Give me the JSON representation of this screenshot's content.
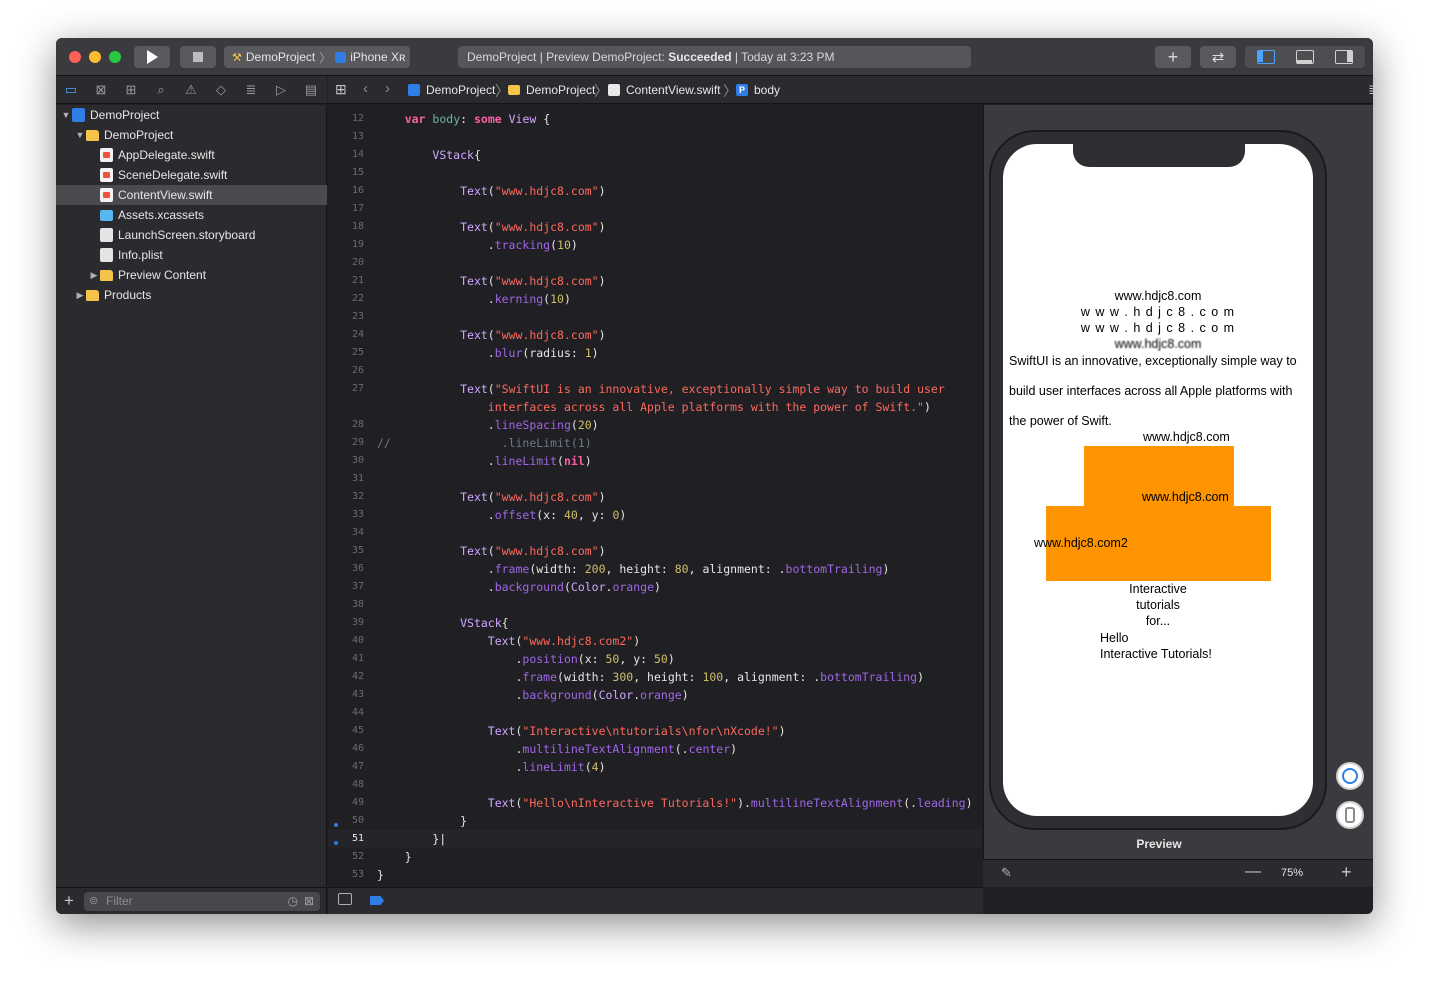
{
  "window": {
    "scheme": {
      "project": "DemoProject",
      "device": "iPhone Xʀ"
    },
    "status": {
      "prefix": "DemoProject | Preview DemoProject: ",
      "result": "Succeeded",
      "time": " | Today at 3:23 PM"
    }
  },
  "navigator": {
    "items": [
      {
        "label": "DemoProject",
        "indent": 0,
        "icon": "project-icon",
        "disclosure": "▼"
      },
      {
        "label": "DemoProject",
        "indent": 1,
        "icon": "folder-icon",
        "disclosure": "▼"
      },
      {
        "label": "AppDelegate.swift",
        "indent": 2,
        "icon": "swift-file-icon",
        "disclosure": ""
      },
      {
        "label": "SceneDelegate.swift",
        "indent": 2,
        "icon": "swift-file-icon",
        "disclosure": ""
      },
      {
        "label": "ContentView.swift",
        "indent": 2,
        "icon": "swift-file-icon",
        "disclosure": "",
        "selected": true
      },
      {
        "label": "Assets.xcassets",
        "indent": 2,
        "icon": "assets-icon",
        "disclosure": ""
      },
      {
        "label": "LaunchScreen.storyboard",
        "indent": 2,
        "icon": "storyboard-icon",
        "disclosure": ""
      },
      {
        "label": "Info.plist",
        "indent": 2,
        "icon": "plist-icon",
        "disclosure": ""
      },
      {
        "label": "Preview Content",
        "indent": 2,
        "icon": "folder-icon",
        "disclosure": "▶"
      },
      {
        "label": "Products",
        "indent": 1,
        "icon": "folder-icon",
        "disclosure": "▶"
      }
    ],
    "filter_placeholder": "Filter"
  },
  "jumpbar": {
    "crumbs": [
      "DemoProject",
      "DemoProject",
      "ContentView.swift",
      "body"
    ]
  },
  "editor": {
    "current_line": "51",
    "lines": [
      {
        "n": "12",
        "html": "    <span class='kw'>var</span> <span class='pr'>body</span>: <span class='kw'>some</span> <span class='ty'>View</span> {"
      },
      {
        "n": "13",
        "html": ""
      },
      {
        "n": "14",
        "html": "        <span class='ty'>VStack</span>{"
      },
      {
        "n": "15",
        "html": ""
      },
      {
        "n": "16",
        "html": "            <span class='ty'>Text</span>(<span class='str'>\"www.hdjc8.com\"</span>)"
      },
      {
        "n": "17",
        "html": ""
      },
      {
        "n": "18",
        "html": "            <span class='ty'>Text</span>(<span class='str'>\"www.hdjc8.com\"</span>)"
      },
      {
        "n": "19",
        "html": "                .<span class='fn'>tracking</span>(<span class='num'>10</span>)"
      },
      {
        "n": "20",
        "html": ""
      },
      {
        "n": "21",
        "html": "            <span class='ty'>Text</span>(<span class='str'>\"www.hdjc8.com\"</span>)"
      },
      {
        "n": "22",
        "html": "                .<span class='fn'>kerning</span>(<span class='num'>10</span>)"
      },
      {
        "n": "23",
        "html": ""
      },
      {
        "n": "24",
        "html": "            <span class='ty'>Text</span>(<span class='str'>\"www.hdjc8.com\"</span>)"
      },
      {
        "n": "25",
        "html": "                .<span class='fn'>blur</span>(radius: <span class='num'>1</span>)"
      },
      {
        "n": "26",
        "html": ""
      },
      {
        "n": "27",
        "html": "            <span class='ty'>Text</span>(<span class='str'>\"SwiftUI is an innovative, exceptionally simple way to build user</span>"
      },
      {
        "n": "",
        "html": "                <span class='str'>interfaces across all Apple platforms with the power of Swift.\"</span>)"
      },
      {
        "n": "28",
        "html": "                .<span class='fn'>lineSpacing</span>(<span class='num'>20</span>)"
      },
      {
        "n": "29",
        "html": "<span class='cm'>//                .lineLimit(1)</span>"
      },
      {
        "n": "30",
        "html": "                .<span class='fn'>lineLimit</span>(<span class='kw'>nil</span>)"
      },
      {
        "n": "31",
        "html": ""
      },
      {
        "n": "32",
        "html": "            <span class='ty'>Text</span>(<span class='str'>\"www.hdjc8.com\"</span>)"
      },
      {
        "n": "33",
        "html": "                .<span class='fn'>offset</span>(x: <span class='num'>40</span>, y: <span class='num'>0</span>)"
      },
      {
        "n": "34",
        "html": ""
      },
      {
        "n": "35",
        "html": "            <span class='ty'>Text</span>(<span class='str'>\"www.hdjc8.com\"</span>)"
      },
      {
        "n": "36",
        "html": "                .<span class='fn'>frame</span>(width: <span class='num'>200</span>, height: <span class='num'>80</span>, alignment: .<span class='fn'>bottomTrailing</span>)"
      },
      {
        "n": "37",
        "html": "                .<span class='fn'>background</span>(<span class='ty'>Color</span>.<span class='fn'>orange</span>)"
      },
      {
        "n": "38",
        "html": ""
      },
      {
        "n": "39",
        "html": "            <span class='ty'>VStack</span>{"
      },
      {
        "n": "40",
        "html": "                <span class='ty'>Text</span>(<span class='str'>\"www.hdjc8.com2\"</span>)"
      },
      {
        "n": "41",
        "html": "                    .<span class='fn'>position</span>(x: <span class='num'>50</span>, y: <span class='num'>50</span>)"
      },
      {
        "n": "42",
        "html": "                    .<span class='fn'>frame</span>(width: <span class='num'>300</span>, height: <span class='num'>100</span>, alignment: .<span class='fn'>bottomTrailing</span>)"
      },
      {
        "n": "43",
        "html": "                    .<span class='fn'>background</span>(<span class='ty'>Color</span>.<span class='fn'>orange</span>)"
      },
      {
        "n": "44",
        "html": ""
      },
      {
        "n": "45",
        "html": "                <span class='ty'>Text</span>(<span class='str'>\"Interactive\\ntutorials\\nfor\\nXcode!\"</span>)"
      },
      {
        "n": "46",
        "html": "                    .<span class='fn'>multilineTextAlignment</span>(.<span class='fn'>center</span>)"
      },
      {
        "n": "47",
        "html": "                    .<span class='fn'>lineLimit</span>(<span class='num'>4</span>)"
      },
      {
        "n": "48",
        "html": ""
      },
      {
        "n": "49",
        "html": "                <span class='ty'>Text</span>(<span class='str'>\"Hello\\nInteractive Tutorials!\"</span>).<span class='fn'>multilineTextAlignment</span>(.<span class='fn'>leading</span>)"
      },
      {
        "n": "50",
        "html": "            }"
      },
      {
        "n": "51",
        "html": "        }|"
      },
      {
        "n": "52",
        "html": "    }"
      },
      {
        "n": "53",
        "html": "}"
      }
    ]
  },
  "preview": {
    "t1": "www.hdjc8.com",
    "t2": "w w w . h d j c 8 . c o m",
    "t3": "w w w . h d j c 8 . c o m",
    "t4": "www.hdjc8.com",
    "para1": "SwiftUI is an innovative, exceptionally simple way to",
    "para2": "build user interfaces across all Apple platforms with",
    "para3": "the power of Swift.",
    "t5": "www.hdjc8.com",
    "t6": "www.hdjc8.com",
    "t7": "www.hdjc8.com2",
    "multi1": "Interactive",
    "multi2": "tutorials",
    "multi3": "for...",
    "hello1": "Hello",
    "hello2": "Interactive Tutorials!",
    "label": "Preview",
    "zoom": "75%",
    "accent_color": "#fe9400"
  }
}
